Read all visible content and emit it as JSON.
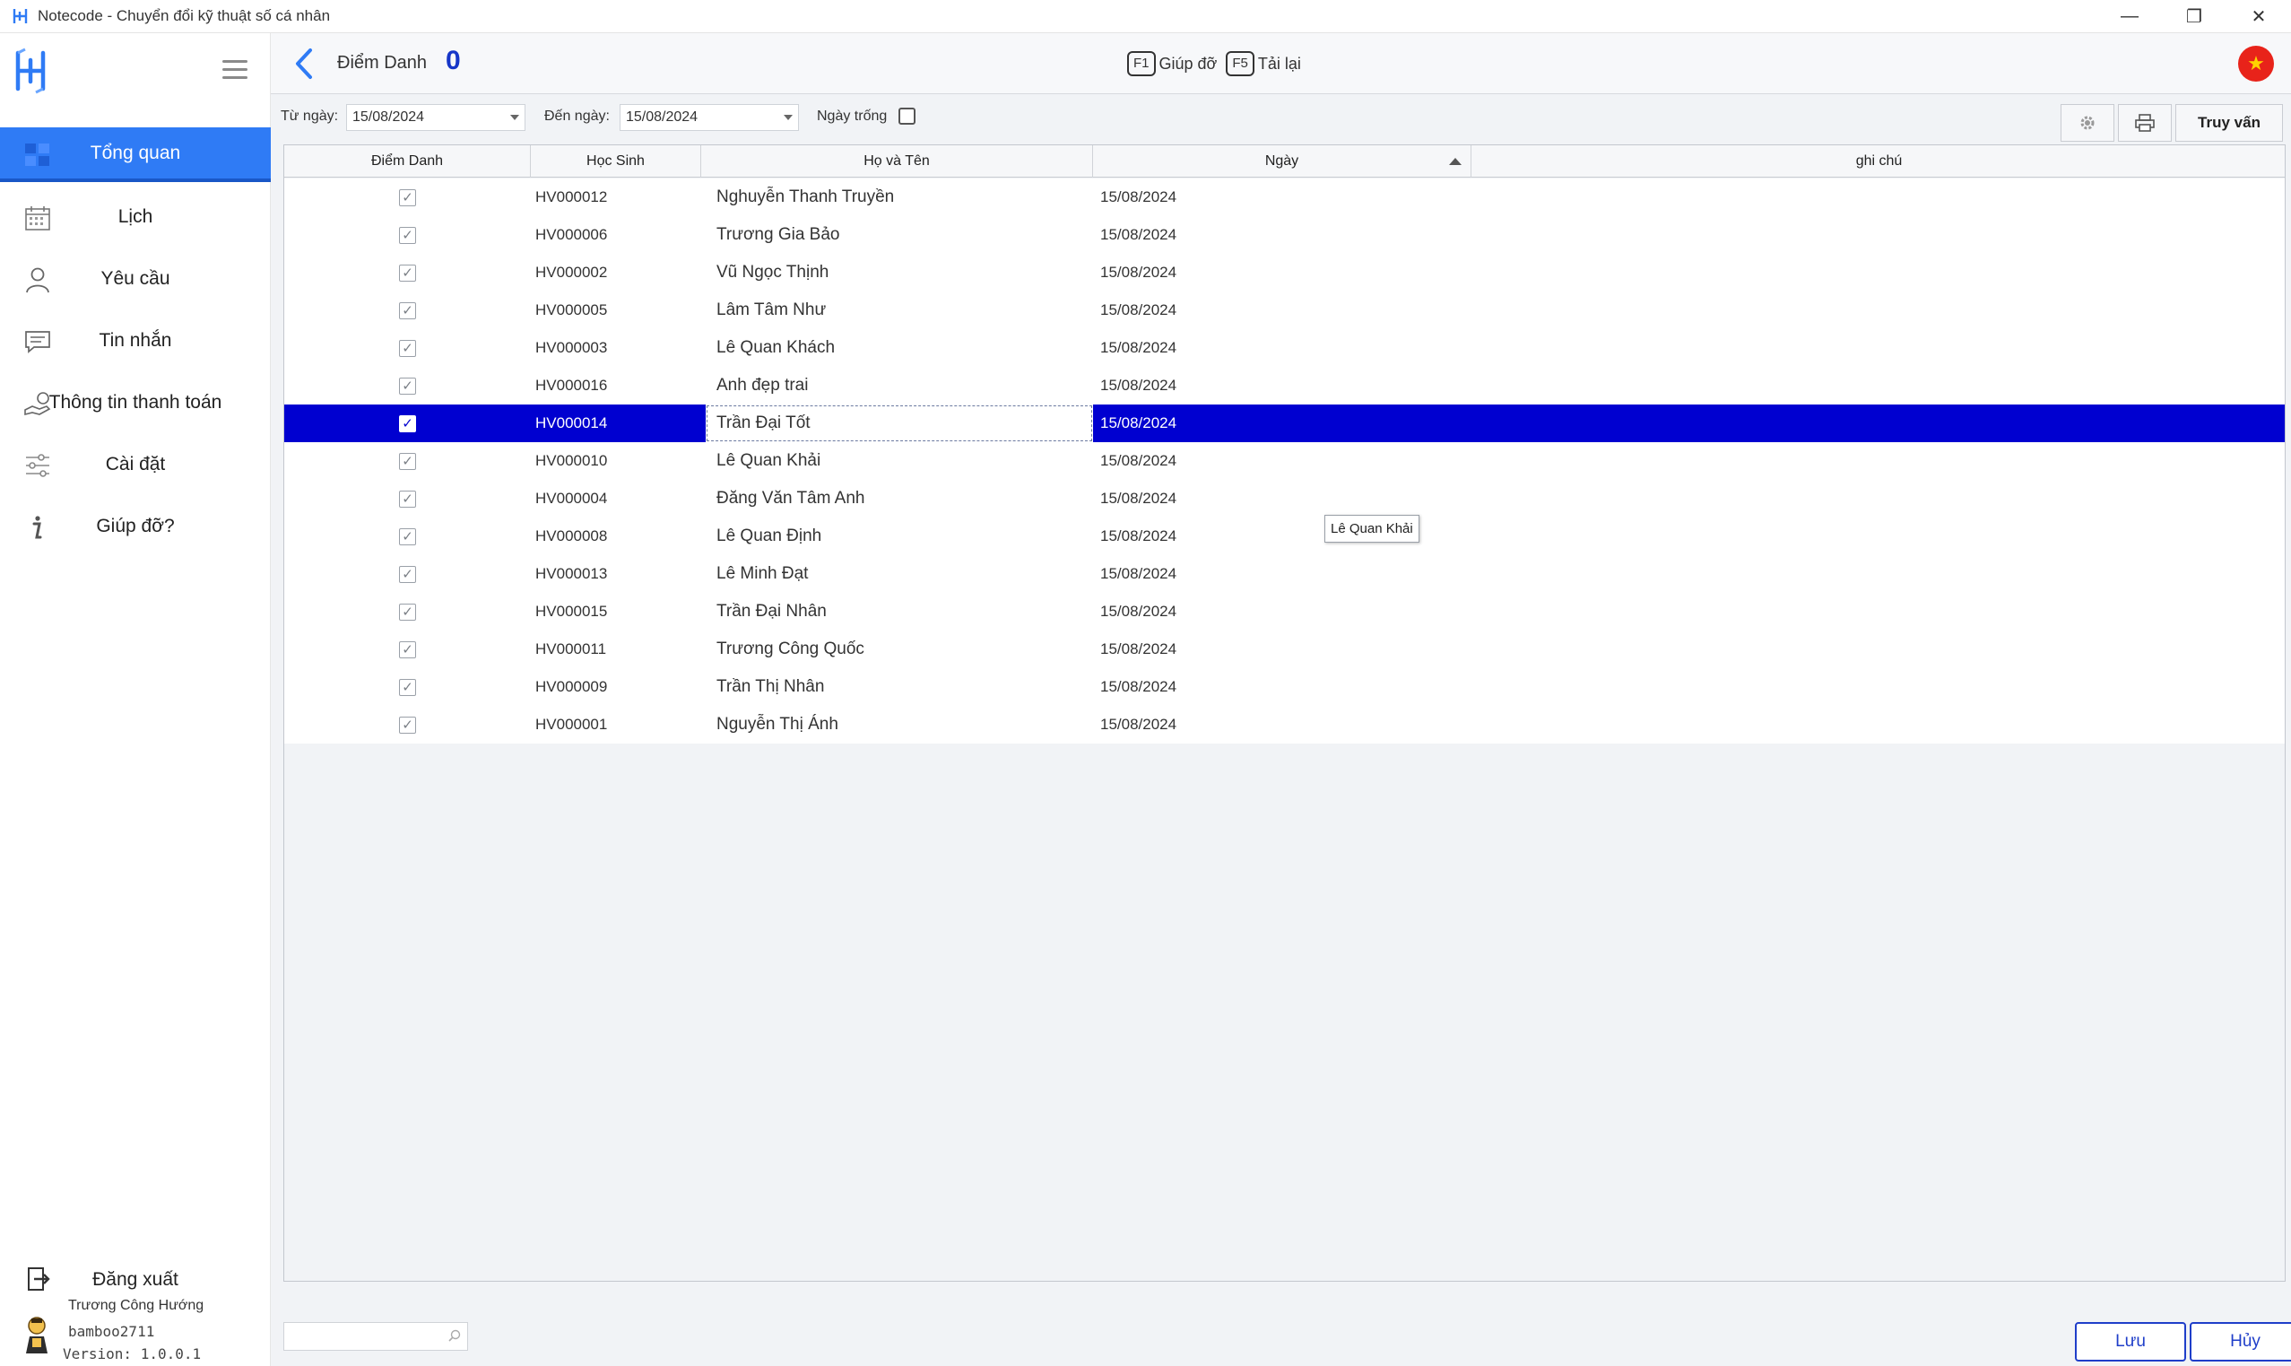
{
  "window": {
    "title": "Notecode - Chuyển đổi kỹ thuật số cá nhân",
    "minimize": "—",
    "restore": "❐",
    "close": "✕"
  },
  "sidebar": {
    "items": [
      {
        "label": "Tổng quan",
        "icon": "dashboard-icon"
      },
      {
        "label": "Lịch",
        "icon": "calendar-icon"
      },
      {
        "label": "Yêu cầu",
        "icon": "user-icon"
      },
      {
        "label": "Tin nhắn",
        "icon": "message-icon"
      },
      {
        "label": "Thông tin thanh toán",
        "icon": "payment-icon"
      },
      {
        "label": "Cài đặt",
        "icon": "settings-icon"
      },
      {
        "label": "Giúp đỡ?",
        "icon": "info-icon"
      }
    ],
    "logout_label": "Đăng xuất",
    "user_name": "Trương Công Hướng",
    "username": "bamboo2711",
    "version": "Version: 1.0.0.1"
  },
  "header": {
    "title": "Điểm Danh",
    "count": "0",
    "help_key": "F1",
    "help_label": "Giúp đỡ",
    "reload_key": "F5",
    "reload_label": "Tải lại",
    "flag": "★"
  },
  "filters": {
    "from_label": "Từ ngày:",
    "from_value": "15/08/2024",
    "to_label": "Đến ngày:",
    "to_value": "15/08/2024",
    "empty_label": "Ngày trống",
    "query_label": "Truy vấn"
  },
  "grid": {
    "columns": [
      "Điểm Danh",
      "Học Sinh",
      "Họ và Tên",
      "Ngày",
      "ghi chú"
    ],
    "sort_column": "Ngày",
    "selected_row": 6,
    "rows": [
      {
        "checked": true,
        "code": "HV000012",
        "name": "Nghuyễn Thanh Truyền",
        "date": "15/08/2024"
      },
      {
        "checked": true,
        "code": "HV000006",
        "name": "Trương Gia Bảo",
        "date": "15/08/2024"
      },
      {
        "checked": true,
        "code": "HV000002",
        "name": "Vũ Ngọc Thịnh",
        "date": "15/08/2024"
      },
      {
        "checked": true,
        "code": "HV000005",
        "name": "Lâm Tâm Như",
        "date": "15/08/2024"
      },
      {
        "checked": true,
        "code": "HV000003",
        "name": "Lê Quan Khách",
        "date": "15/08/2024"
      },
      {
        "checked": true,
        "code": "HV000016",
        "name": "Anh đẹp trai",
        "date": "15/08/2024"
      },
      {
        "checked": true,
        "code": "HV000014",
        "name": "Trần Đại Tốt",
        "date": "15/08/2024"
      },
      {
        "checked": true,
        "code": "HV000010",
        "name": "Lê Quan Khải",
        "date": "15/08/2024"
      },
      {
        "checked": true,
        "code": "HV000004",
        "name": "Đăng Văn Tâm Anh",
        "date": "15/08/2024"
      },
      {
        "checked": true,
        "code": "HV000008",
        "name": "Lê Quan Định",
        "date": "15/08/2024"
      },
      {
        "checked": true,
        "code": "HV000013",
        "name": "Lê Minh Đạt",
        "date": "15/08/2024"
      },
      {
        "checked": true,
        "code": "HV000015",
        "name": "Trần Đại Nhân",
        "date": "15/08/2024"
      },
      {
        "checked": true,
        "code": "HV000011",
        "name": "Trương Công Quốc",
        "date": "15/08/2024"
      },
      {
        "checked": true,
        "code": "HV000009",
        "name": "Trần Thị Nhân",
        "date": "15/08/2024"
      },
      {
        "checked": true,
        "code": "HV000001",
        "name": "Nguyễn Thị Ánh",
        "date": "15/08/2024"
      }
    ],
    "tooltip": "Lê Quan Khải"
  },
  "footer": {
    "save_label": "Lưu",
    "cancel_label": "Hủy"
  },
  "colors": {
    "accent": "#2f7bf5",
    "selection": "#0000d0",
    "count": "#1636c8"
  }
}
